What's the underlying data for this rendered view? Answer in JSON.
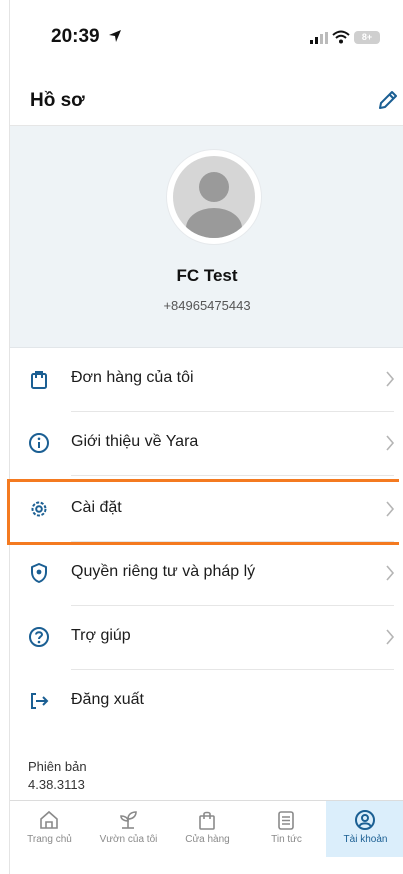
{
  "status_bar": {
    "time": "20:39",
    "battery": "8+"
  },
  "header": {
    "title": "Hồ sơ"
  },
  "profile": {
    "name": "FC Test",
    "phone": "+84965475443"
  },
  "menu": {
    "items": [
      {
        "label": "Đơn hàng của tôi",
        "icon": "shopping-bag-icon"
      },
      {
        "label": "Giới thiệu về Yara",
        "icon": "info-icon"
      },
      {
        "label": "Cài đặt",
        "icon": "gear-icon"
      },
      {
        "label": "Quyền riêng tư và pháp lý",
        "icon": "shield-icon"
      },
      {
        "label": "Trợ giúp",
        "icon": "help-icon"
      },
      {
        "label": "Đăng xuất",
        "icon": "logout-icon"
      }
    ]
  },
  "version": {
    "label": "Phiên bản",
    "number": "4.38.3113"
  },
  "tabs": [
    {
      "label": "Trang chủ",
      "icon": "home-icon"
    },
    {
      "label": "Vườn của tôi",
      "icon": "sprout-icon"
    },
    {
      "label": "Cửa hàng",
      "icon": "shopping-bag-icon"
    },
    {
      "label": "Tin tức",
      "icon": "news-icon"
    },
    {
      "label": "Tài khoản",
      "icon": "account-icon",
      "active": true
    }
  ],
  "colors": {
    "accent": "#1b5f93",
    "highlight": "#f47a20",
    "profile_bg": "#eef3f6",
    "active_tab_bg": "#dbeefb"
  }
}
